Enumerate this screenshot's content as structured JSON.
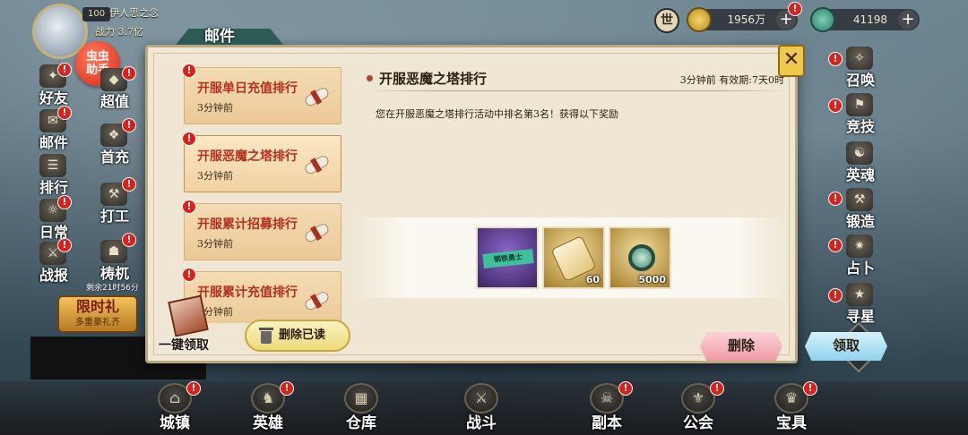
{
  "player": {
    "level": "100",
    "name": "伊人思之念",
    "power_label": "战力 3.7亿"
  },
  "assistant": {
    "label": "虫虫\n助手"
  },
  "top_resources": [
    {
      "icon": "gold-coin-icon",
      "value": "1956万"
    },
    {
      "icon": "jade-coin-icon",
      "value": "41198"
    }
  ],
  "world_chat": {
    "label": "世"
  },
  "left_menu": [
    {
      "id": "friends",
      "label": "好友"
    },
    {
      "id": "value",
      "label": "超值"
    },
    {
      "id": "mail",
      "label": "邮件"
    },
    {
      "id": "first-charge",
      "label": "首充"
    },
    {
      "id": "rank",
      "label": "排行"
    },
    {
      "id": "daily",
      "label": "日常"
    },
    {
      "id": "work",
      "label": "打工"
    },
    {
      "id": "battle-report",
      "label": "战报"
    },
    {
      "id": "stake",
      "label": "梼杌"
    }
  ],
  "limited_gift": {
    "title": "限时礼",
    "subtitle": "多重豪礼齐",
    "timer": "剩余21时56分"
  },
  "right_menu": [
    {
      "id": "summon",
      "label": "召唤"
    },
    {
      "id": "arena",
      "label": "竞技"
    },
    {
      "id": "hero-soul",
      "label": "英魂"
    },
    {
      "id": "forge",
      "label": "锻造"
    },
    {
      "id": "divination",
      "label": "占卜"
    },
    {
      "id": "star-seek",
      "label": "寻星"
    }
  ],
  "bottom_menu": [
    {
      "id": "town",
      "label": "城镇"
    },
    {
      "id": "heroes",
      "label": "英雄"
    },
    {
      "id": "warehouse",
      "label": "仓库"
    },
    {
      "id": "battle",
      "label": "战斗"
    },
    {
      "id": "dungeon",
      "label": "副本"
    },
    {
      "id": "guild",
      "label": "公会"
    },
    {
      "id": "treasure",
      "label": "宝具"
    }
  ],
  "mail": {
    "window_title": "邮件",
    "list": [
      {
        "subject": "开服单日充值排行",
        "time": "3分钟前"
      },
      {
        "subject": "开服恶魔之塔排行",
        "time": "3分钟前"
      },
      {
        "subject": "开服累计招募排行",
        "time": "3分钟前"
      },
      {
        "subject": "开服累计充值排行",
        "time": "3分钟前"
      }
    ],
    "selected": {
      "title": "开服恶魔之塔排行",
      "meta": "3分钟前  有效期:7天0时",
      "body": "您在开服恶魔之塔排行活动中排名第3名！获得以下奖励",
      "rewards": [
        {
          "name": "title-card",
          "chip": "钢铁勇士",
          "qty": ""
        },
        {
          "name": "scroll",
          "qty": "60"
        },
        {
          "name": "jade-coin",
          "qty": "5000"
        }
      ]
    },
    "buttons": {
      "delete": "删除",
      "claim": "领取",
      "delete_read": "删除已读",
      "claim_all": "一键领取"
    }
  },
  "colors": {
    "subject_red": "#b3301d",
    "parchment": "#efe6d4",
    "delete_pink": "#ef9aa6",
    "claim_blue": "#8fd3ec",
    "badge_red": "#d8221b"
  }
}
